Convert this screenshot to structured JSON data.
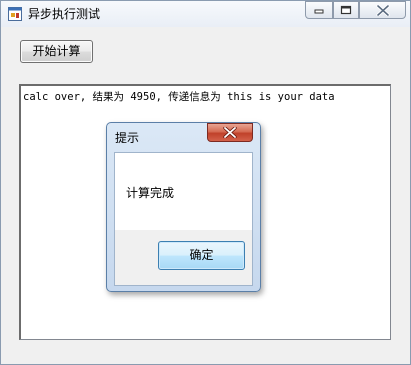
{
  "window": {
    "title": "异步执行测试",
    "icons": {
      "app": "app-window-icon",
      "minimize": "minimize-icon",
      "maximize": "maximize-icon",
      "close": "close-icon"
    }
  },
  "main": {
    "start_button": "开始计算",
    "output_text": "calc over, 结果为 4950, 传递信息为 this is your data"
  },
  "dialog": {
    "title": "提示",
    "message": "计算完成",
    "ok_button": "确定",
    "icons": {
      "close": "close-icon"
    }
  },
  "colors": {
    "dialog_close": "#c0412a",
    "ok_button_border": "#3c7fb1",
    "window_frame": "#f0f0f0"
  }
}
